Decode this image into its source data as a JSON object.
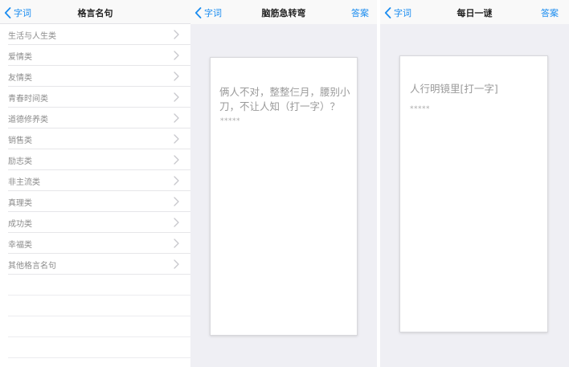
{
  "screen1": {
    "back_label": "字词",
    "title": "格言名句",
    "items": [
      {
        "label": "生活与人生类"
      },
      {
        "label": "爱情类"
      },
      {
        "label": "友情类"
      },
      {
        "label": "青春时间类"
      },
      {
        "label": "道德修养类"
      },
      {
        "label": "销售类"
      },
      {
        "label": "励志类"
      },
      {
        "label": "非主流类"
      },
      {
        "label": "真理类"
      },
      {
        "label": "成功类"
      },
      {
        "label": "幸福类"
      },
      {
        "label": "其他格言名句"
      }
    ]
  },
  "screen2": {
    "back_label": "字词",
    "title": "脑筋急转弯",
    "action_label": "答案",
    "question": "俩人不对，整整仨月，腰别小刀，不让人知（打一字）？",
    "answer_mask": "*****"
  },
  "screen3": {
    "back_label": "字词",
    "title": "每日一谜",
    "action_label": "答案",
    "question": "人行明镜里[打一字]",
    "answer_mask": "*****"
  },
  "colors": {
    "accent": "#1a8cf0",
    "background": "#efeff4",
    "list_text": "#8c8c8c"
  }
}
